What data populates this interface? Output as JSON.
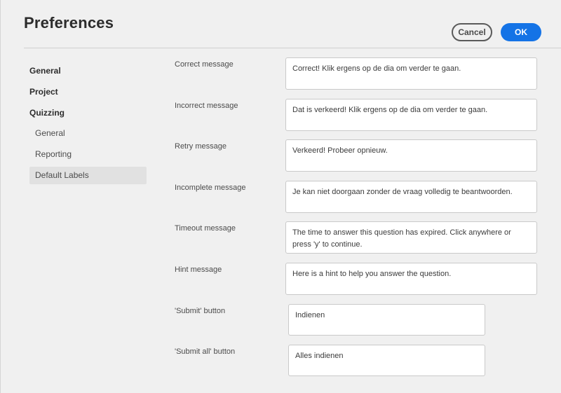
{
  "header": {
    "title": "Preferences",
    "cancel_label": "Cancel",
    "ok_label": "OK"
  },
  "sidebar": {
    "items": [
      {
        "label": "General"
      },
      {
        "label": "Project"
      },
      {
        "label": "Quizzing"
      }
    ],
    "quizzing_children": [
      {
        "label": "General"
      },
      {
        "label": "Reporting"
      },
      {
        "label": "Default Labels",
        "selected": true
      }
    ]
  },
  "fields": [
    {
      "label": "Correct message",
      "value": "Correct! Klik ergens op de dia om verder te gaan."
    },
    {
      "label": "Incorrect message",
      "value": "Dat is verkeerd!  Klik ergens op de dia om verder te gaan."
    },
    {
      "label": "Retry message",
      "value": "Verkeerd! Probeer opnieuw."
    },
    {
      "label": "Incomplete message",
      "value": "Je kan niet doorgaan zonder de vraag volledig te beantwoorden."
    },
    {
      "label": "Timeout message",
      "value": "The time to answer this question has expired. Click anywhere or press 'y' to continue."
    },
    {
      "label": "Hint message",
      "value": "Here is a hint to help you answer the question."
    },
    {
      "label": "'Submit' button",
      "value": "Indienen"
    },
    {
      "label": "'Submit all' button",
      "value": "Alles indienen"
    }
  ],
  "colors": {
    "accent": "#1473e6",
    "background": "#f0f0f0",
    "selected_nav": "#e1e1e1"
  }
}
